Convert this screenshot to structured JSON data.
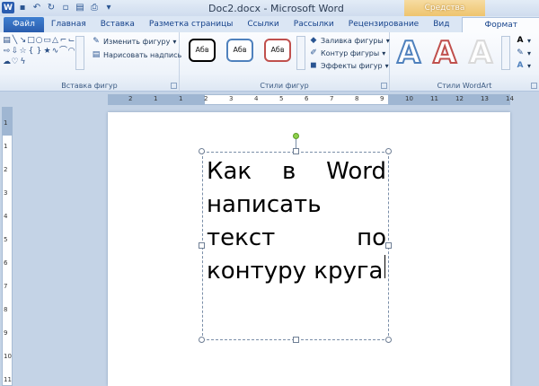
{
  "window": {
    "title": "Doc2.docx - Microsoft Word",
    "contextual_tab_group": "Средства рисования"
  },
  "tabs": [
    {
      "label": "Файл"
    },
    {
      "label": "Главная"
    },
    {
      "label": "Вставка"
    },
    {
      "label": "Разметка страницы"
    },
    {
      "label": "Ссылки"
    },
    {
      "label": "Рассылки"
    },
    {
      "label": "Рецензирование"
    },
    {
      "label": "Вид"
    },
    {
      "label": "Формат"
    }
  ],
  "ribbon": {
    "insert_shapes": {
      "label": "Вставка фигур",
      "edit_shape": "Изменить фигуру",
      "draw_textbox": "Нарисовать надпись"
    },
    "shape_styles": {
      "label": "Стили фигур",
      "style_sample": "Абв",
      "fill": "Заливка фигуры",
      "outline": "Контур фигуры",
      "effects": "Эффекты фигур",
      "colors": [
        "#000000",
        "#4f81bd",
        "#c0504d"
      ]
    },
    "wordart": {
      "label": "Стили WordArt",
      "sample": "A",
      "colors": [
        "#4f81bd",
        "#c0504d",
        "#d9d9d9"
      ]
    }
  },
  "ruler": {
    "h_numbers": [
      "2",
      "1",
      "1",
      "2",
      "3",
      "4",
      "5",
      "6",
      "7",
      "8",
      "9",
      "10",
      "11",
      "12",
      "13",
      "14"
    ],
    "v_numbers": [
      "1",
      "1",
      "2",
      "3",
      "4",
      "5",
      "6",
      "7",
      "8",
      "9",
      "10",
      "11"
    ]
  },
  "document": {
    "lines": [
      [
        "Как",
        "в",
        "Word"
      ],
      [
        "написать"
      ],
      [
        "текст",
        "по"
      ],
      [
        "контуру круга"
      ]
    ]
  }
}
